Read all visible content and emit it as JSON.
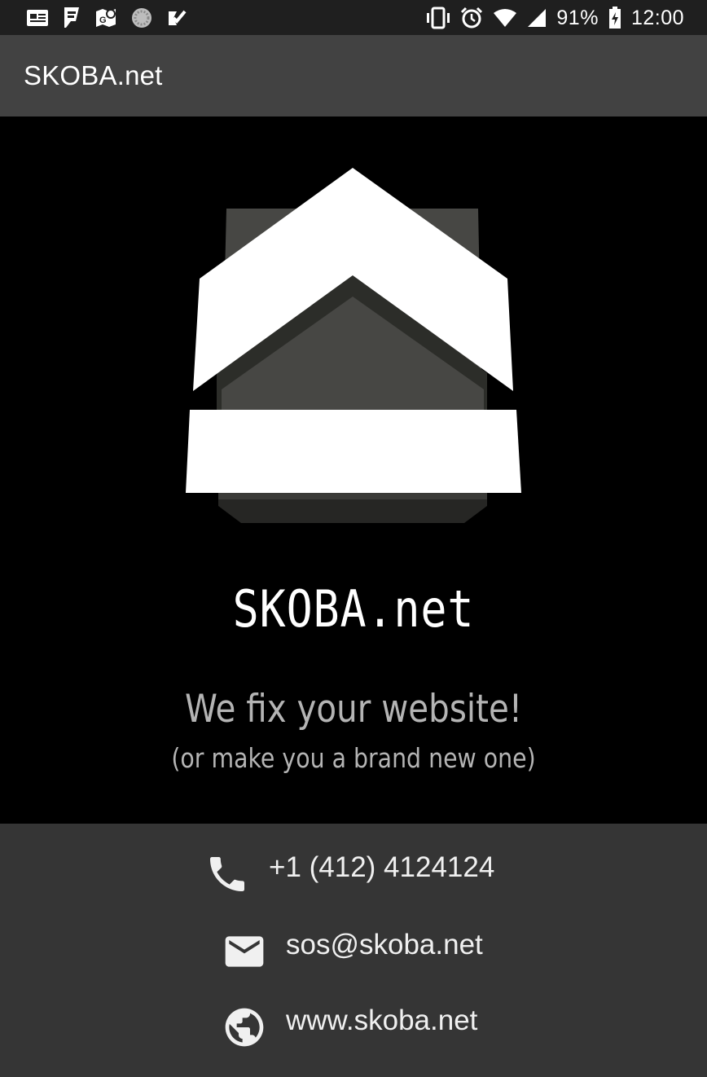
{
  "status_bar": {
    "battery": "91%",
    "time": "12:00",
    "left_icons": [
      "news-icon",
      "foursquare-icon",
      "maps-icon",
      "loading-icon",
      "inbox-icon"
    ],
    "right_icons": [
      "vibrate-icon",
      "alarm-icon",
      "wifi-icon",
      "signal-icon",
      "battery-charging-icon"
    ]
  },
  "app_bar": {
    "title": "SKOBA.net"
  },
  "hero": {
    "brand": "SKOBA.net",
    "tagline": "We fix your website!",
    "subtagline": "(or make you a brand new one)"
  },
  "contacts": [
    {
      "icon": "phone-icon",
      "text": "+1 (412) 4124124"
    },
    {
      "icon": "email-icon",
      "text": "sos@skoba.net"
    },
    {
      "icon": "globe-icon",
      "text": "www.skoba.net"
    }
  ],
  "colors": {
    "status_bar": "#1f1f1f",
    "app_bar": "#424242",
    "hero_background": "#000000",
    "contact_panel": "#353535",
    "tagline": "#b4b4b4",
    "logo_white": "#ffffff",
    "logo_gray": "#474744"
  }
}
